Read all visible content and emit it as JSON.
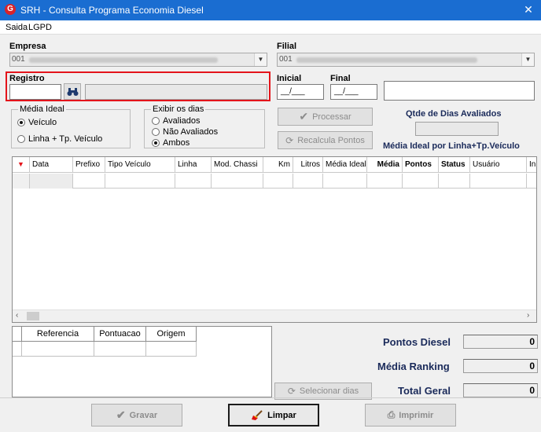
{
  "window": {
    "title": "SRH - Consulta Programa Economia Diesel",
    "close": "✕",
    "icon": "G"
  },
  "menu": {
    "items": [
      "Saida",
      "LGPD"
    ]
  },
  "empresa": {
    "label": "Empresa",
    "value": "001"
  },
  "filial": {
    "label": "Filial",
    "value": "001"
  },
  "registro": {
    "label": "Registro",
    "value": "",
    "name_value": ""
  },
  "inicial": {
    "label": "Inicial",
    "value": "__/___"
  },
  "final": {
    "label": "Final",
    "value": "__/___"
  },
  "media_ideal": {
    "title": "Média Ideal",
    "options": [
      "Veículo",
      "Linha + Tp. Veículo"
    ],
    "selected": 0
  },
  "exibir_dias": {
    "title": "Exibir os dias",
    "options": [
      "Avaliados",
      "Não Avaliados",
      "Ambos"
    ],
    "selected": 2
  },
  "buttons": {
    "processar": "Processar",
    "recalcula": "Recalcula Pontos",
    "selecionar": "Selecionar dias",
    "gravar": "Gravar",
    "limpar": "Limpar",
    "imprimir": "Imprimir"
  },
  "qtde": {
    "label": "Qtde de Dias Avaliados",
    "value": ""
  },
  "media_linha_label": "Média Ideal por Linha+Tp.Veículo",
  "grid": {
    "columns": [
      "",
      "Data",
      "Prefixo",
      "Tipo Veículo",
      "Linha",
      "Mod. Chassi",
      "Km",
      "Litros",
      "Média Ideal",
      "Média",
      "Pontos",
      "Status",
      "Usuário",
      "In"
    ]
  },
  "grid2": {
    "columns": [
      "",
      "Referencia",
      "Pontuacao",
      "Origem"
    ]
  },
  "totals": {
    "pontos_diesel": {
      "label": "Pontos Diesel",
      "value": "0"
    },
    "media_ranking": {
      "label": "Média Ranking",
      "value": "0"
    },
    "total_geral": {
      "label": "Total Geral",
      "value": "0"
    }
  },
  "colors": {
    "titlebar": "#1a6dd1",
    "highlight": "#e4141b",
    "totals_label": "#1a2a5a"
  }
}
